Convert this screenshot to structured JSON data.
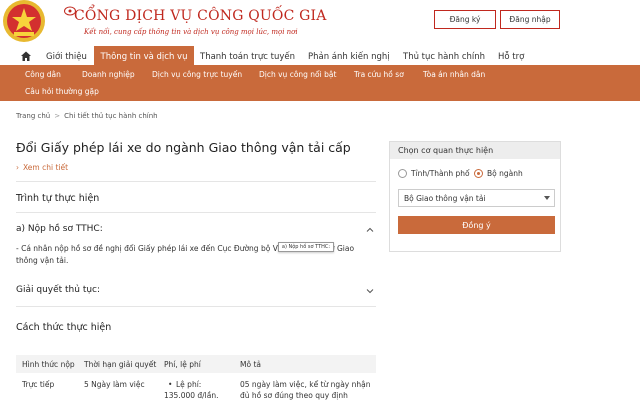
{
  "header": {
    "title": "CỔNG DỊCH VỤ CÔNG QUỐC GIA",
    "subtitle": "Kết nối, cung cấp thông tin và dịch vụ công mọi lúc, mọi nơi",
    "register_label": "Đăng ký",
    "login_label": "Đăng nhập"
  },
  "main_nav": {
    "items": [
      {
        "label": "Giới thiệu"
      },
      {
        "label": "Thông tin và dịch vụ"
      },
      {
        "label": "Thanh toán trực tuyến"
      },
      {
        "label": "Phản ánh kiến nghị"
      },
      {
        "label": "Thủ tục hành chính"
      },
      {
        "label": "Hỗ trợ"
      }
    ]
  },
  "sub_nav": {
    "items": [
      {
        "label": "Công dân"
      },
      {
        "label": "Doanh nghiệp"
      },
      {
        "label": "Dịch vụ công trực tuyến"
      },
      {
        "label": "Dịch vụ công nổi bật"
      },
      {
        "label": "Tra cứu hồ sơ"
      },
      {
        "label": "Tòa án nhân dân"
      },
      {
        "label": "Câu hỏi thường gặp"
      }
    ]
  },
  "breadcrumb": {
    "home": "Trang chủ",
    "separator": ">",
    "current": "Chi tiết thủ tục hành chính"
  },
  "procedure": {
    "title": "Đổi Giấy phép lái xe do ngành Giao thông vận tải cấp",
    "details_link": "Xem chi tiết",
    "sequence_title": "Trình tự thực hiện",
    "step_a_title": "a) Nộp hồ sơ TTHC:",
    "step_a_text_line1": "- Cá nhân nộp hồ sơ đề nghị đổi Giấy phép lái xe đến Cục Đường bộ V",
    "step_a_text_line1_end": "ở Giao",
    "step_a_text_line2": "thông vận tải.",
    "tooltip": "a) Nộp hồ sơ TTHC:",
    "step_b_title": "Giải quyết thủ tục:",
    "method_title": "Cách thức thực hiện"
  },
  "table": {
    "headers": [
      "Hình thức nộp",
      "Thời hạn giải quyết",
      "Phí, lệ phí",
      "Mô tả"
    ],
    "rows": [
      {
        "form": "Trực tiếp",
        "duration": "5 Ngày làm việc",
        "fee_line1": "Lệ phí:",
        "fee_line2": "135.000 đ/lần.",
        "desc_line1": "05 ngày làm việc, kể từ ngày nhận",
        "desc_line2": "đủ hồ sơ đúng theo quy định"
      }
    ]
  },
  "agency_panel": {
    "title": "Chọn cơ quan thực hiện",
    "option_province": "Tỉnh/Thành phố",
    "option_ministry": "Bộ ngành",
    "selected_agency": "Bộ Giao thông vận tải",
    "submit_label": "Đồng ý"
  },
  "colors": {
    "brand_red": "#c0281e",
    "accent_orange": "#c96a3b"
  }
}
